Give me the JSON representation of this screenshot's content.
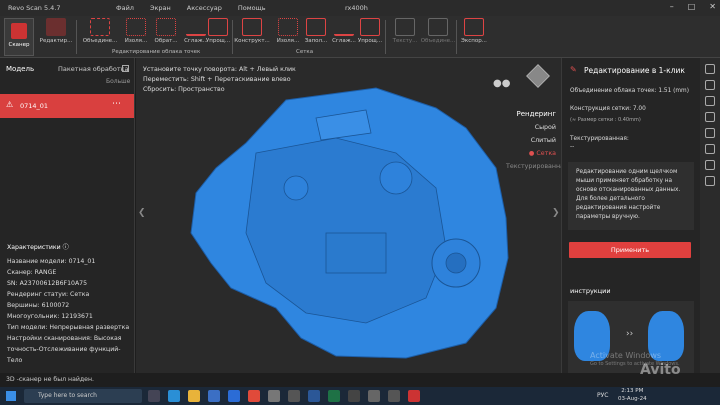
{
  "app": {
    "title": "Revo Scan 5.4.7",
    "document": "rx400h",
    "menu": [
      "Файл",
      "Экран",
      "Аксессуар",
      "Помощь"
    ]
  },
  "ribbon": {
    "scanner_label": "Сканер",
    "edit_label": "Редактир...",
    "merge_label": "Объедине...",
    "isolate_label": "Изоля...",
    "crop_label": "Обрат...",
    "smooth_label": "Сглаж...",
    "simplify_label": "Упрощ...",
    "construct_label": "Конструкт...",
    "isolate2_label": "Изоля...",
    "fill_label": "Запол...",
    "smooth2_label": "Сглаж...",
    "simplify2_label": "Упрощ...",
    "texture_label": "Тексту...",
    "merge2_label": "Объедине...",
    "export_label": "Экспор...",
    "group_pointcloud": "Редактирование облака точек",
    "group_mesh": "Сетка"
  },
  "left_panel": {
    "title": "Модель",
    "batch_label": "Пакетная обработка",
    "more_label": "Больше",
    "model_item": "0714_01",
    "props_title": "Характеристики",
    "props": [
      "Название модели:  0714_01",
      "Сканер:  RANGE",
      "SN:  A23700612B6F10A75",
      "Рендеринг статуи:  Сетка",
      "Вершины:  6100072",
      "Многоугольник:  12193671",
      "Тип модели:  Непрерывная развертка",
      "Настройки сканирования:  Высокая",
      "точность-Отслеживание функций-Тело"
    ]
  },
  "viewport": {
    "hints": [
      "Установите точку поворота: Alt + Левый клик",
      "Переместить: Shift + Перетаскивание влево",
      "Сбросить: Пространство"
    ],
    "render_title": "Рендеринг",
    "render_modes": [
      "Сырой",
      "Слитый",
      "Сетка",
      "Текстурированная"
    ]
  },
  "right_panel": {
    "title": "Редактирование в 1-клик",
    "merge_label": "Объединение облака точек:  1.51 (mm)",
    "mesh_label": "Конструкция сетки:  7.00",
    "mesh_sub": "(≈ Размер сетки : 0.40mm)",
    "textured_label": "Текстурированная:",
    "textured_value": "--",
    "info": "Редактирование одним щелчком мыши применяет обработку на основе отсканированных данных. Для более детального редактирования настройте параметры вручную.",
    "apply_label": "Применить",
    "instructions_label": "инструкции"
  },
  "status": {
    "text": "3D -сканер не был найден."
  },
  "taskbar": {
    "search_placeholder": "Type here to search",
    "lang": "РУС",
    "time": "2:13 PM",
    "date": "03-Aug-24"
  },
  "watermark": {
    "line1": "Activate Windows",
    "line2": "Go to Settings to activate Windows.",
    "avito": "Avito"
  },
  "colors": {
    "accent": "#e0403e",
    "model": "#2f86e0"
  }
}
